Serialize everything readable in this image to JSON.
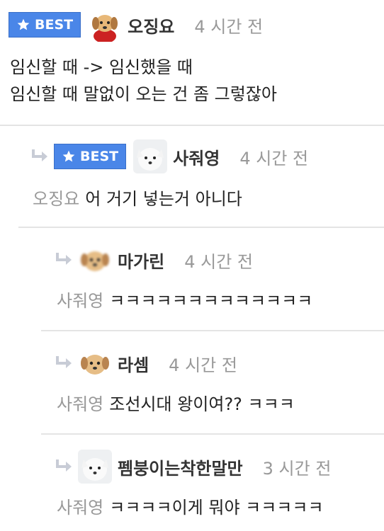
{
  "comments": [
    {
      "best": "BEST",
      "name": "오징요",
      "time": "4 시간 전",
      "lines": [
        "임신할 때 -> 임신했을 때",
        "임신할 때 말없이 오는 건 좀 그렇잖아"
      ],
      "avatar": "puppy-cape"
    },
    {
      "best": "BEST",
      "name": "사줘영",
      "time": "4 시간 전",
      "mention": "오징요",
      "text": "어 거기 넣는거 아니다",
      "avatar": "white-dog"
    },
    {
      "name": "마가린",
      "time": "4 시간 전",
      "mention": "사줘영",
      "text": "ㅋㅋㅋㅋㅋㅋㅋㅋㅋㅋㅋㅋㅋ",
      "avatar": "puppy-blur"
    },
    {
      "name": "라셈",
      "time": "4 시간 전",
      "mention": "사줘영",
      "text": "조선시대 왕이여?? ㅋㅋㅋ",
      "avatar": "puppy"
    },
    {
      "name": "펨붕이는착한말만",
      "time": "3 시간 전",
      "mention": "사줘영",
      "text": "ㅋㅋㅋㅋ이게 뭐야 ㅋㅋㅋㅋㅋ",
      "avatar": "white-dog"
    }
  ],
  "colors": {
    "best": "#4a86e8",
    "muted": "#999999",
    "divider": "#e4e4e4"
  }
}
